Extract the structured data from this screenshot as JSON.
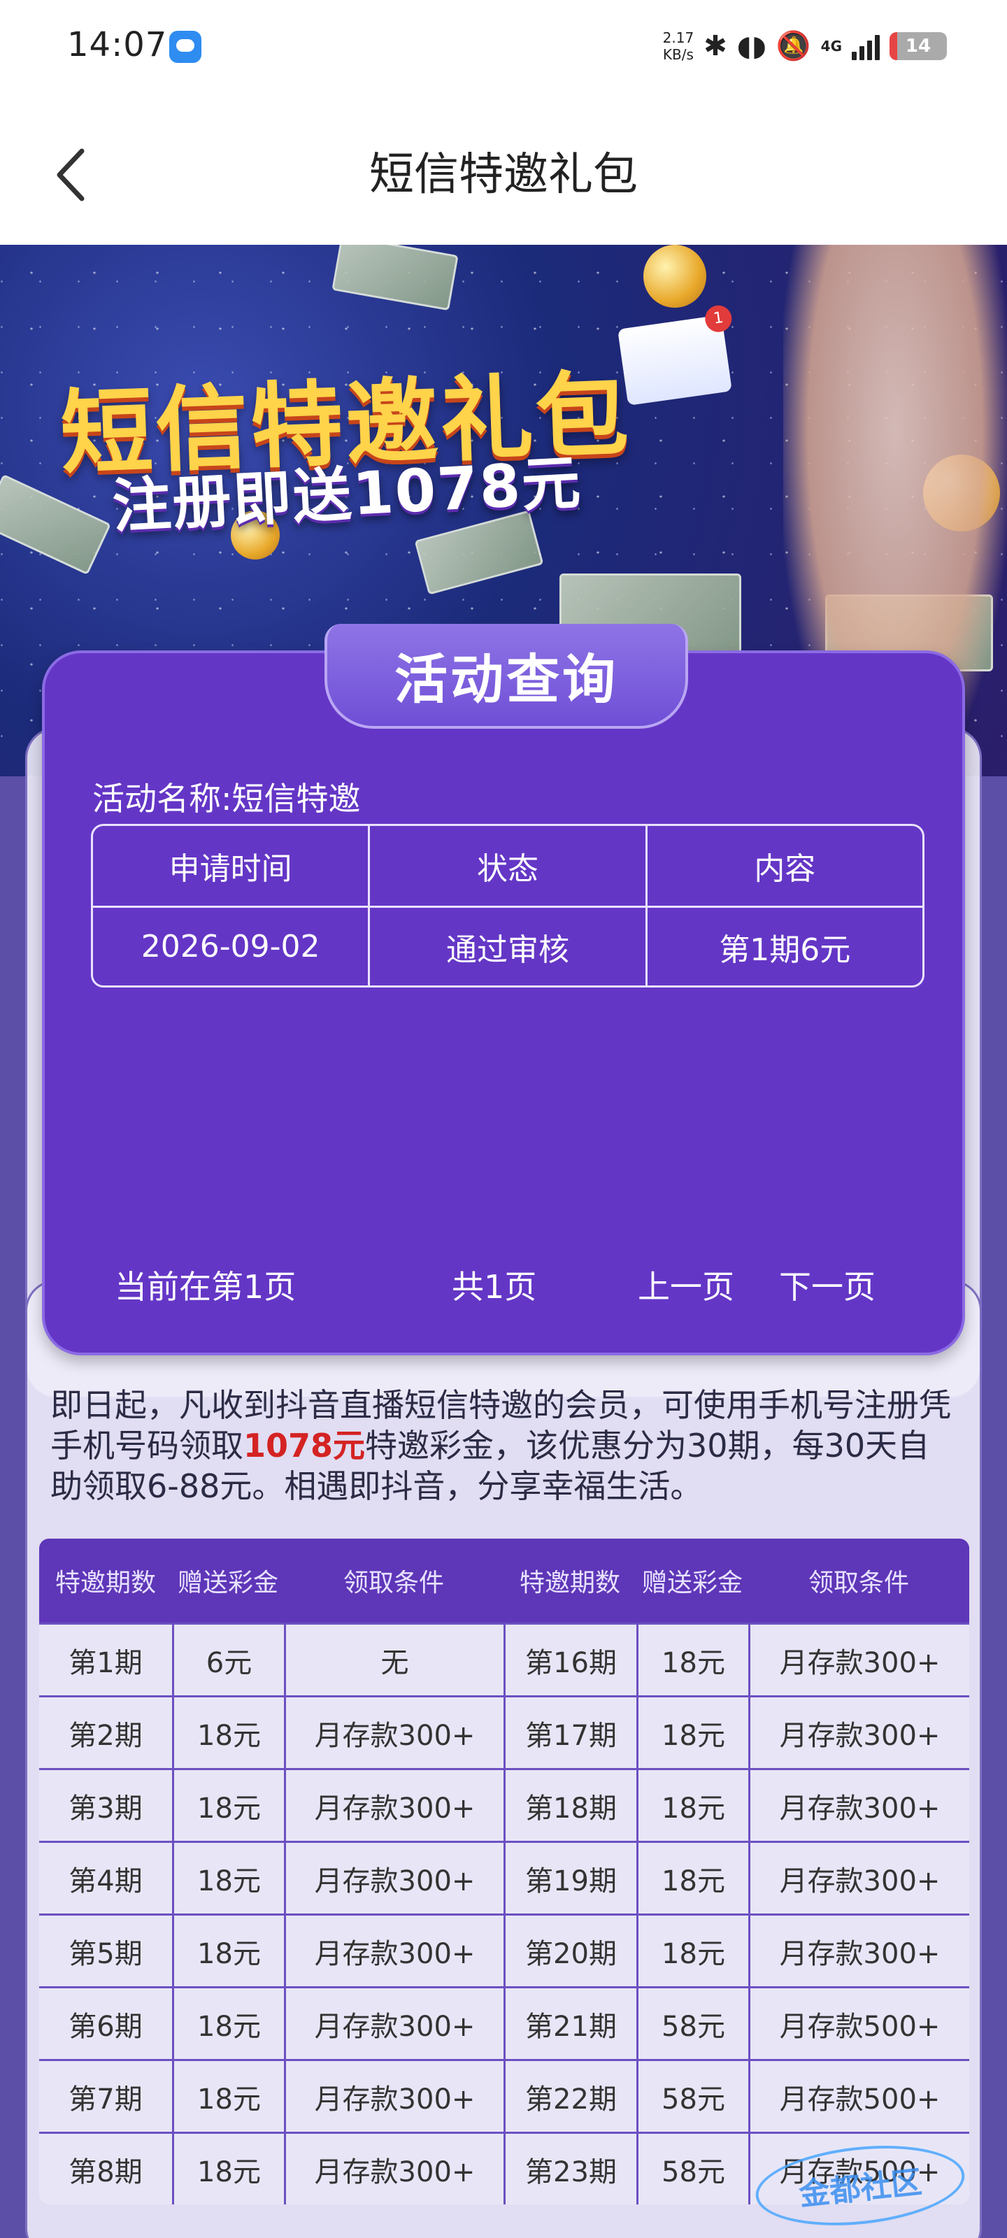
{
  "status_bar": {
    "time": "14:07",
    "speed_value": "2.17",
    "speed_unit": "KB/s",
    "network": "4G",
    "battery": "14",
    "battery_level": 0.14
  },
  "header": {
    "title": "短信特邀礼包"
  },
  "banner": {
    "title": "短信特邀礼包",
    "subtitle": "注册即送1078元",
    "mail_badge": "1"
  },
  "query": {
    "tab_title": "活动查询",
    "activity_name": "活动名称:短信特邀",
    "columns": [
      "申请时间",
      "状态",
      "内容"
    ],
    "rows": [
      [
        "2026-09-02",
        "通过审核",
        "第1期6元"
      ]
    ],
    "pager": {
      "current": "当前在第1页",
      "total": "共1页",
      "prev": "上一页",
      "next": "下一页"
    }
  },
  "description": {
    "part1": "即日起，凡收到抖音直播短信特邀的会员，可使用手机号注册凭手机号码领取",
    "highlight": "1078元",
    "part2": "特邀彩金，该优惠分为30期，每30天自助领取6-88元。相遇即抖音，分享幸福生活。"
  },
  "periods": {
    "headers": [
      "特邀期数",
      "赠送彩金",
      "领取条件",
      "特邀期数",
      "赠送彩金",
      "领取条件"
    ],
    "rows": [
      [
        "第1期",
        "6元",
        "无",
        "第16期",
        "18元",
        "月存款300+"
      ],
      [
        "第2期",
        "18元",
        "月存款300+",
        "第17期",
        "18元",
        "月存款300+"
      ],
      [
        "第3期",
        "18元",
        "月存款300+",
        "第18期",
        "18元",
        "月存款300+"
      ],
      [
        "第4期",
        "18元",
        "月存款300+",
        "第19期",
        "18元",
        "月存款300+"
      ],
      [
        "第5期",
        "18元",
        "月存款300+",
        "第20期",
        "18元",
        "月存款300+"
      ],
      [
        "第6期",
        "18元",
        "月存款300+",
        "第21期",
        "58元",
        "月存款500+"
      ],
      [
        "第7期",
        "18元",
        "月存款300+",
        "第22期",
        "58元",
        "月存款500+"
      ],
      [
        "第8期",
        "18元",
        "月存款300+",
        "第23期",
        "58元",
        "月存款500+"
      ]
    ]
  },
  "watermark": "金都社区"
}
